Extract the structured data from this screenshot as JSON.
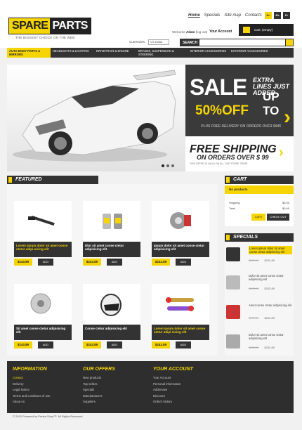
{
  "header": {
    "logo_left": "SPARE",
    "logo_right": "PARTS",
    "tagline": "THE BIGGEST CHOICE ON THE WEB",
    "topnav": [
      "Home",
      "Specials",
      "Site map",
      "Contacts"
    ],
    "languages": [
      "En",
      "Es",
      "Fr"
    ],
    "welcome_prefix": "Welcome",
    "welcome_user": "Adam",
    "logout": "(log out)",
    "your_account": "Your Account",
    "cart_label": "Cart: (empty)",
    "currency_label": "Currencies:",
    "currency_value": "US Dollar",
    "search_label": "SEARCH"
  },
  "menu": [
    "AUTO BODY PARTS & MIRRORS",
    "HEADLIGHTS & LIGHTING",
    "DRIVETRAIN & ENGINE",
    "BRAKES, SUSPENSION & STEERING",
    "INTERIOR ACCESSORIES",
    "EXTERIOR ACCESSORIES"
  ],
  "promo": {
    "sale": "SALE",
    "extra": "EXTRA LINES JUST ADDED",
    "upto": "UP TO",
    "percent": "50%OFF",
    "plus": "PLUS FREE DELIVERY ON ORDERS OVER $945",
    "free_shipping": "FREE SHIPPING",
    "on_orders": "ON ORDERS OVER $ 99",
    "fine_print": "THIS OFFER IS VALID ON ALL OUR STORE ITEMS"
  },
  "featured": {
    "title": "FEATURED",
    "products": [
      {
        "title": "Lorem ipsum dolor sit amet conse ctetur adipi-sicing elit",
        "price": "$243.89",
        "add": "ADD"
      },
      {
        "title": "Dlor sit amet conse ctetur adipisicing elit",
        "price": "$243.89",
        "add": "ADD"
      },
      {
        "title": "Ipsum dolor sit amet conse ctetur adipisicing elit",
        "price": "$243.89",
        "add": "ADD"
      },
      {
        "title": "Sit amet conse ctetur adipisicing elit",
        "price": "$243.89",
        "add": "ADD"
      },
      {
        "title": "Conse ctetur adipisicing elit",
        "price": "$243.89",
        "add": "ADD"
      },
      {
        "title": "Lorem ipsum dolor sit amet conse ctetur adipi-sicing elit",
        "price": "$243.89",
        "add": "ADD"
      }
    ]
  },
  "cart": {
    "title": "CART",
    "no_products": "No products",
    "shipping_label": "Shipping",
    "shipping_value": "$0.00",
    "total_label": "Total",
    "total_value": "$0.00",
    "cart_btn": "CART",
    "checkout_btn": "CHECK OUT"
  },
  "specials": {
    "title": "SPECIALS",
    "items": [
      {
        "title": "Lorem ipsum dolor sit amet conse ctetur adipisicing elit",
        "old": "$245.89",
        "new": "$243.89"
      },
      {
        "title": "Dolor sit amet conse ctetur adipisicing elit",
        "old": "$245.89",
        "new": "$243.89"
      },
      {
        "title": "Amet conse ctetur adipisicing elit",
        "old": "$245.89",
        "new": "$243.89"
      },
      {
        "title": "Dolor sit amet conse ctetur adipisicing elit",
        "old": "$245.89",
        "new": "$243.89"
      }
    ]
  },
  "footer": {
    "information": {
      "title": "INFORMATION",
      "links": [
        "Contact",
        "Delivery",
        "Legal Notice",
        "Terms and conditions of use",
        "About us"
      ]
    },
    "offers": {
      "title": "OUR OFFERS",
      "links": [
        "New products",
        "Top sellers",
        "Specials",
        "Manufacturers",
        "Suppliers"
      ]
    },
    "account": {
      "title": "YOUR ACCOUNT",
      "links": [
        "Your Account",
        "Personal information",
        "Addresses",
        "Discount",
        "Orders history"
      ]
    },
    "copyright": "© 2012 Powered by Presta Shop™. All Rights Reserved"
  },
  "colors": {
    "accent": "#f5d400",
    "dark": "#333333"
  }
}
